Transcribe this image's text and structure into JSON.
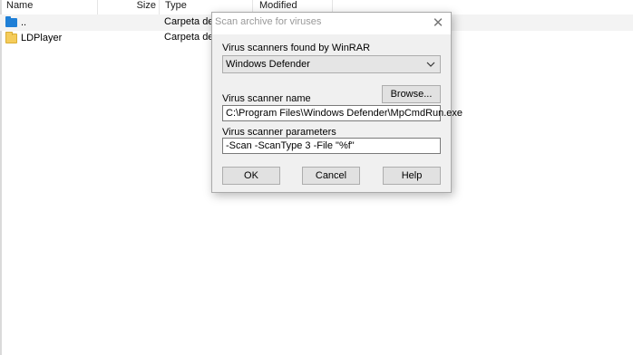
{
  "columns": {
    "name": "Name",
    "size": "Size",
    "type": "Type",
    "modified": "Modified"
  },
  "files": [
    {
      "name": "..",
      "type": "Carpeta de",
      "icon": "parent-folder-icon"
    },
    {
      "name": "LDPlayer",
      "type": "Carpeta de",
      "icon": "folder-icon"
    }
  ],
  "dialog": {
    "title": "Scan archive for viruses",
    "found_label": "Virus scanners found by WinRAR",
    "scanner_selected": "Windows Defender",
    "browse_label": "Browse...",
    "scanner_name_label": "Virus scanner name",
    "scanner_name_value": "C:\\Program Files\\Windows Defender\\MpCmdRun.exe",
    "params_label": "Virus scanner parameters",
    "params_value": "-Scan -ScanType 3 -File \"%f\"",
    "ok_label": "OK",
    "cancel_label": "Cancel",
    "help_label": "Help"
  }
}
